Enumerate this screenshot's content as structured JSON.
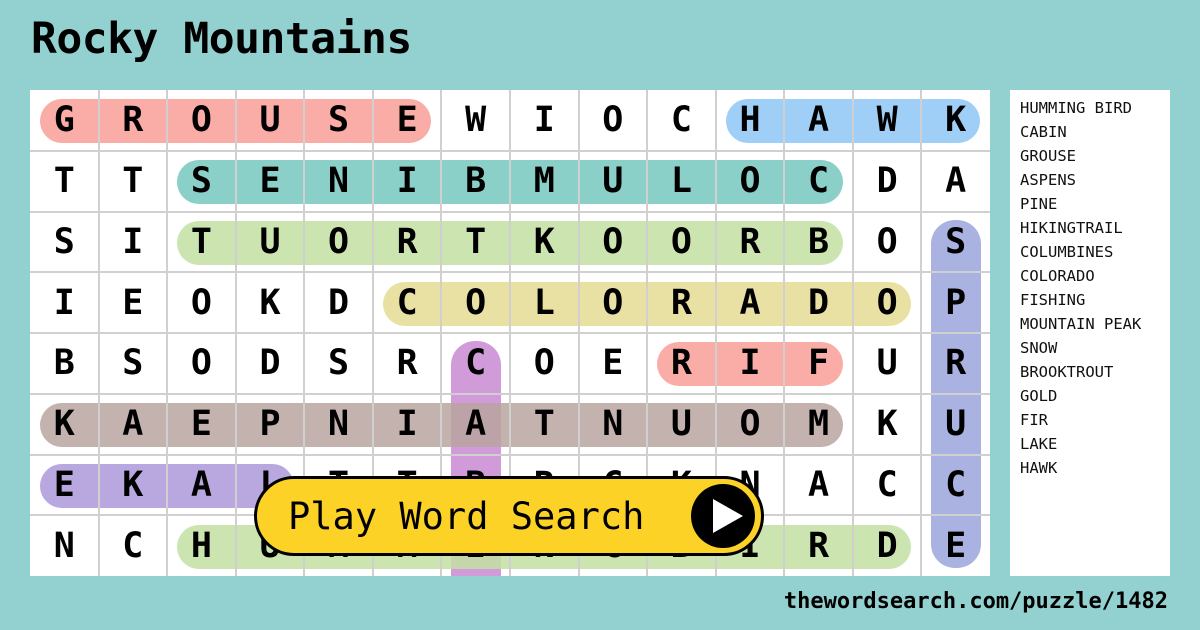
{
  "title": "Rocky Mountains",
  "grid": {
    "rows": [
      [
        "G",
        "R",
        "O",
        "U",
        "S",
        "E",
        "W",
        "I",
        "O",
        "C",
        "H",
        "A",
        "W",
        "K"
      ],
      [
        "T",
        "T",
        "S",
        "E",
        "N",
        "I",
        "B",
        "M",
        "U",
        "L",
        "O",
        "C",
        "D",
        "A"
      ],
      [
        "S",
        "I",
        "T",
        "U",
        "O",
        "R",
        "T",
        "K",
        "O",
        "O",
        "R",
        "B",
        "O",
        "S"
      ],
      [
        "I",
        "E",
        "O",
        "K",
        "D",
        "C",
        "O",
        "L",
        "O",
        "R",
        "A",
        "D",
        "O",
        "P"
      ],
      [
        "B",
        "S",
        "O",
        "D",
        "S",
        "R",
        "C",
        "O",
        "E",
        "R",
        "I",
        "F",
        "U",
        "R"
      ],
      [
        "K",
        "A",
        "E",
        "P",
        "N",
        "I",
        "A",
        "T",
        "N",
        "U",
        "O",
        "M",
        "K",
        "U"
      ],
      [
        "E",
        "K",
        "A",
        "L",
        "T",
        "T",
        "B",
        "R",
        "C",
        "K",
        "N",
        "A",
        "C",
        "C"
      ],
      [
        "N",
        "C",
        "H",
        "U",
        "M",
        "M",
        "I",
        "N",
        "G",
        "B",
        "I",
        "R",
        "D",
        "E"
      ]
    ],
    "found": [
      {
        "word": "GROUSE",
        "row": 0,
        "col": 0,
        "dir": "h",
        "len": 6,
        "color": "#f99e97"
      },
      {
        "word": "HAWK",
        "row": 0,
        "col": 10,
        "dir": "h",
        "len": 4,
        "color": "#8ec6f4"
      },
      {
        "word": "COLUMBINES",
        "row": 1,
        "col": 2,
        "dir": "h",
        "len": 10,
        "color": "#76c8c0"
      },
      {
        "word": "BROOKTROUT",
        "row": 2,
        "col": 2,
        "dir": "h",
        "len": 10,
        "color": "#c3e1a2"
      },
      {
        "word": "COLORADO",
        "row": 3,
        "col": 5,
        "dir": "h",
        "len": 8,
        "color": "#e5dc93"
      },
      {
        "word": "SPRUCE",
        "row": 2,
        "col": 13,
        "dir": "v",
        "len": 6,
        "color": "#9aa4db"
      },
      {
        "word": "CABIN",
        "row": 4,
        "col": 6,
        "dir": "v",
        "len": 5,
        "color": "#c98ad4"
      },
      {
        "word": "FIR",
        "row": 4,
        "col": 9,
        "dir": "h",
        "len": 3,
        "color": "#f99e97"
      },
      {
        "word": "MOUNTAIN PEAK",
        "row": 5,
        "col": 0,
        "dir": "h",
        "len": 12,
        "color": "#b8a59f"
      },
      {
        "word": "LAKE",
        "row": 6,
        "col": 0,
        "dir": "h",
        "len": 4,
        "color": "#ad98db"
      },
      {
        "word": "HUMMING BIRD",
        "row": 7,
        "col": 2,
        "dir": "h",
        "len": 11,
        "color": "#c3e1a2"
      }
    ]
  },
  "word_list": [
    "HUMMING BIRD",
    "CABIN",
    "GROUSE",
    "ASPENS",
    "PINE",
    "HIKINGTRAIL",
    "COLUMBINES",
    "COLORADO",
    "FISHING",
    "MOUNTAIN PEAK",
    "SNOW",
    "BROOKTROUT",
    "GOLD",
    "FIR",
    "LAKE",
    "HAWK"
  ],
  "play_button": {
    "label": "Play Word Search",
    "icon": "play-icon"
  },
  "footer": {
    "url": "thewordsearch.com/puzzle/1482"
  },
  "colors": {
    "background": "#93d1d0",
    "button": "#fdd227"
  }
}
